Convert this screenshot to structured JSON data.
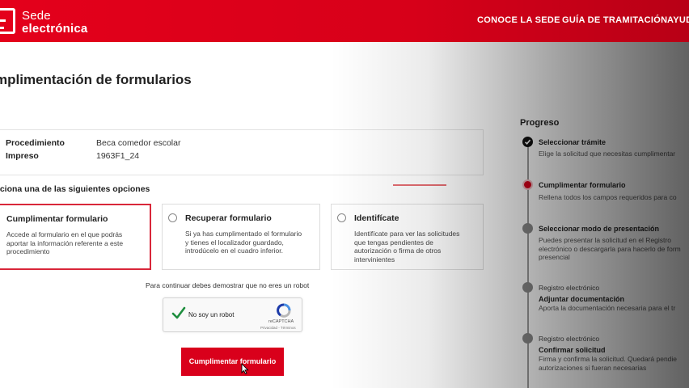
{
  "header": {
    "logo_line1": "Sede",
    "logo_line2": "electrónica",
    "nav": [
      "CONOCE LA SEDE",
      "GUÍA DE TRAMITACIÓN",
      "AYUD"
    ],
    "brand_color": "#e4001b"
  },
  "page": {
    "title": "mplimentación de formularios"
  },
  "info": {
    "rows": [
      {
        "label": "Procedimiento",
        "value": "Beca comedor escolar"
      },
      {
        "label": "Impreso",
        "value": "1963F1_24"
      }
    ]
  },
  "options": {
    "heading": "cciona una de las siguientes opciones",
    "items": [
      {
        "title": "Cumplimentar formulario",
        "desc": [
          "Accede al formulario en el que podrás",
          "aportar la información referente a este",
          "procedimiento"
        ],
        "selected": true
      },
      {
        "title": "Recuperar formulario",
        "desc": [
          "Si ya has cumplimentado el formulario",
          "y tienes el localizador guardado,",
          "introdúcelo en el cuadro inferior."
        ],
        "selected": false
      },
      {
        "title": "Identifícate",
        "desc": [
          "Identifícate para ver las solicitudes",
          "que tengas pendientes de",
          "autorización o firma de otros",
          "intervinientes"
        ],
        "selected": false
      }
    ]
  },
  "captcha": {
    "prompt": "Para continuar debes demostrar que no eres un robot",
    "label": "No soy un robot",
    "brand": "reCAPTCHA",
    "links": "Privacidad - Términos",
    "checked": true
  },
  "submit": {
    "label": "Cumplimentar formulario"
  },
  "progress": {
    "title": "Progreso",
    "steps": [
      {
        "pre": "",
        "title": "Seleccionar trámite",
        "desc": [
          "Elige la solicitud que necesitas cumplimentar"
        ],
        "state": "done"
      },
      {
        "pre": "",
        "title": "Cumplimentar formulario",
        "desc": [
          "Rellena todos los campos requeridos para co"
        ],
        "state": "current"
      },
      {
        "pre": "",
        "title": "Seleccionar modo de presentación",
        "desc": [
          "Puedes presentar la solicitud en el Registro",
          "electrónico o descargarla para hacerlo de form",
          "presencial"
        ],
        "state": "pending"
      },
      {
        "pre": "Registro electrónico",
        "title": "Adjuntar documentación",
        "desc": [
          "Aporta la documentación necesaria para el tr"
        ],
        "state": "pending"
      },
      {
        "pre": "Registro electrónico",
        "title": "Confirmar solicitud",
        "desc": [
          "Firma y confirma la solicitud. Quedará pendie",
          "autorizaciones si fueran necesarias"
        ],
        "state": "pending"
      }
    ]
  }
}
